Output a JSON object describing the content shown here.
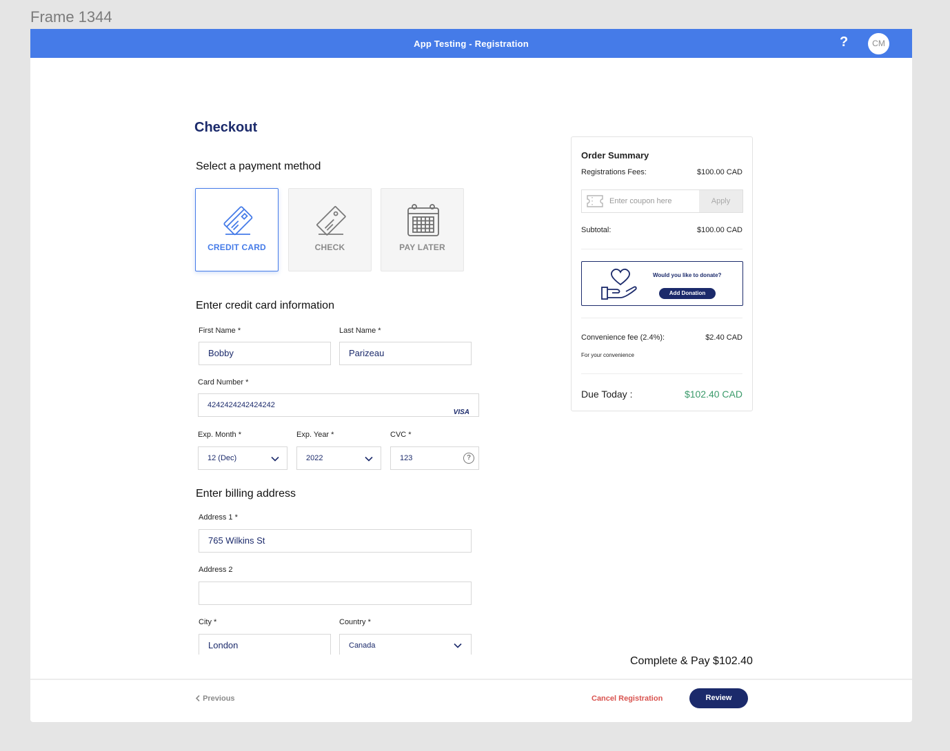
{
  "frame_label": "Frame 1344",
  "header": {
    "title": "App Testing - Registration",
    "help": "?",
    "avatar_initials": "CM"
  },
  "checkout": {
    "title": "Checkout",
    "payment_section_title": "Select a payment method",
    "payment_methods": [
      {
        "label": "CREDIT CARD",
        "icon": "credit-card-icon",
        "selected": true
      },
      {
        "label": "CHECK",
        "icon": "check-icon",
        "selected": false
      },
      {
        "label": "PAY LATER",
        "icon": "calendar-icon",
        "selected": false
      }
    ],
    "card_section_title": "Enter credit card information",
    "first_name": {
      "label": "First Name *",
      "value": "Bobby"
    },
    "last_name": {
      "label": "Last Name *",
      "value": "Parizeau"
    },
    "card_number": {
      "label": "Card Number *",
      "value": "4242424242424242",
      "brand": "VISA"
    },
    "exp_month": {
      "label": "Exp. Month *",
      "value": "12 (Dec)"
    },
    "exp_year": {
      "label": "Exp. Year *",
      "value": "2022"
    },
    "cvc": {
      "label": "CVC *",
      "value": "123",
      "help": "?"
    },
    "billing_section_title": "Enter billing address",
    "address1": {
      "label": "Address 1 *",
      "value": "765 Wilkins St"
    },
    "address2": {
      "label": "Address 2",
      "value": ""
    },
    "city": {
      "label": "City *",
      "value": "London"
    },
    "country": {
      "label": "Country *",
      "value": "Canada"
    }
  },
  "summary": {
    "title": "Order Summary",
    "registration_fees_label": "Registrations Fees:",
    "registration_fees_value": "$100.00 CAD",
    "coupon_placeholder": "Enter coupon here",
    "coupon_apply": "Apply",
    "subtotal_label": "Subtotal:",
    "subtotal_value": "$100.00 CAD",
    "donate_question": "Would you like to donate?",
    "donate_button": "Add Donation",
    "convenience_label": "Convenience fee (2.4%):",
    "convenience_value": "$2.40 CAD",
    "convenience_note": "For your convenience",
    "due_label": "Due Today :",
    "due_value": "$102.40 CAD"
  },
  "complete_pay": "Complete & Pay $102.40",
  "footer": {
    "previous": "Previous",
    "cancel": "Cancel Registration",
    "review": "Review"
  },
  "colors": {
    "primary": "#457be8",
    "navy": "#1b2a6b",
    "success": "#3a9a6a",
    "danger": "#d9534f"
  }
}
